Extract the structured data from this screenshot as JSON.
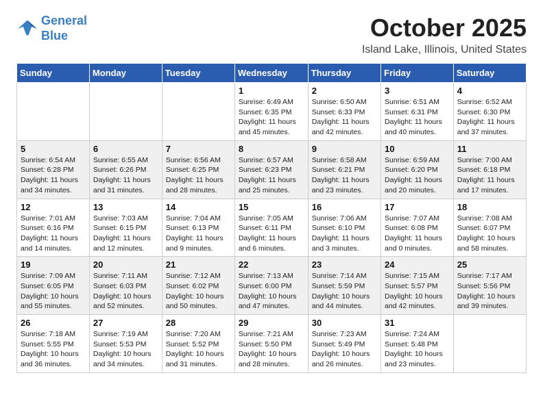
{
  "logo": {
    "line1": "General",
    "line2": "Blue"
  },
  "title": "October 2025",
  "location": "Island Lake, Illinois, United States",
  "weekdays": [
    "Sunday",
    "Monday",
    "Tuesday",
    "Wednesday",
    "Thursday",
    "Friday",
    "Saturday"
  ],
  "weeks": [
    [
      {
        "day": "",
        "info": ""
      },
      {
        "day": "",
        "info": ""
      },
      {
        "day": "",
        "info": ""
      },
      {
        "day": "1",
        "info": "Sunrise: 6:49 AM\nSunset: 6:35 PM\nDaylight: 11 hours\nand 45 minutes."
      },
      {
        "day": "2",
        "info": "Sunrise: 6:50 AM\nSunset: 6:33 PM\nDaylight: 11 hours\nand 42 minutes."
      },
      {
        "day": "3",
        "info": "Sunrise: 6:51 AM\nSunset: 6:31 PM\nDaylight: 11 hours\nand 40 minutes."
      },
      {
        "day": "4",
        "info": "Sunrise: 6:52 AM\nSunset: 6:30 PM\nDaylight: 11 hours\nand 37 minutes."
      }
    ],
    [
      {
        "day": "5",
        "info": "Sunrise: 6:54 AM\nSunset: 6:28 PM\nDaylight: 11 hours\nand 34 minutes."
      },
      {
        "day": "6",
        "info": "Sunrise: 6:55 AM\nSunset: 6:26 PM\nDaylight: 11 hours\nand 31 minutes."
      },
      {
        "day": "7",
        "info": "Sunrise: 6:56 AM\nSunset: 6:25 PM\nDaylight: 11 hours\nand 28 minutes."
      },
      {
        "day": "8",
        "info": "Sunrise: 6:57 AM\nSunset: 6:23 PM\nDaylight: 11 hours\nand 25 minutes."
      },
      {
        "day": "9",
        "info": "Sunrise: 6:58 AM\nSunset: 6:21 PM\nDaylight: 11 hours\nand 23 minutes."
      },
      {
        "day": "10",
        "info": "Sunrise: 6:59 AM\nSunset: 6:20 PM\nDaylight: 11 hours\nand 20 minutes."
      },
      {
        "day": "11",
        "info": "Sunrise: 7:00 AM\nSunset: 6:18 PM\nDaylight: 11 hours\nand 17 minutes."
      }
    ],
    [
      {
        "day": "12",
        "info": "Sunrise: 7:01 AM\nSunset: 6:16 PM\nDaylight: 11 hours\nand 14 minutes."
      },
      {
        "day": "13",
        "info": "Sunrise: 7:03 AM\nSunset: 6:15 PM\nDaylight: 11 hours\nand 12 minutes."
      },
      {
        "day": "14",
        "info": "Sunrise: 7:04 AM\nSunset: 6:13 PM\nDaylight: 11 hours\nand 9 minutes."
      },
      {
        "day": "15",
        "info": "Sunrise: 7:05 AM\nSunset: 6:11 PM\nDaylight: 11 hours\nand 6 minutes."
      },
      {
        "day": "16",
        "info": "Sunrise: 7:06 AM\nSunset: 6:10 PM\nDaylight: 11 hours\nand 3 minutes."
      },
      {
        "day": "17",
        "info": "Sunrise: 7:07 AM\nSunset: 6:08 PM\nDaylight: 11 hours\nand 0 minutes."
      },
      {
        "day": "18",
        "info": "Sunrise: 7:08 AM\nSunset: 6:07 PM\nDaylight: 10 hours\nand 58 minutes."
      }
    ],
    [
      {
        "day": "19",
        "info": "Sunrise: 7:09 AM\nSunset: 6:05 PM\nDaylight: 10 hours\nand 55 minutes."
      },
      {
        "day": "20",
        "info": "Sunrise: 7:11 AM\nSunset: 6:03 PM\nDaylight: 10 hours\nand 52 minutes."
      },
      {
        "day": "21",
        "info": "Sunrise: 7:12 AM\nSunset: 6:02 PM\nDaylight: 10 hours\nand 50 minutes."
      },
      {
        "day": "22",
        "info": "Sunrise: 7:13 AM\nSunset: 6:00 PM\nDaylight: 10 hours\nand 47 minutes."
      },
      {
        "day": "23",
        "info": "Sunrise: 7:14 AM\nSunset: 5:59 PM\nDaylight: 10 hours\nand 44 minutes."
      },
      {
        "day": "24",
        "info": "Sunrise: 7:15 AM\nSunset: 5:57 PM\nDaylight: 10 hours\nand 42 minutes."
      },
      {
        "day": "25",
        "info": "Sunrise: 7:17 AM\nSunset: 5:56 PM\nDaylight: 10 hours\nand 39 minutes."
      }
    ],
    [
      {
        "day": "26",
        "info": "Sunrise: 7:18 AM\nSunset: 5:55 PM\nDaylight: 10 hours\nand 36 minutes."
      },
      {
        "day": "27",
        "info": "Sunrise: 7:19 AM\nSunset: 5:53 PM\nDaylight: 10 hours\nand 34 minutes."
      },
      {
        "day": "28",
        "info": "Sunrise: 7:20 AM\nSunset: 5:52 PM\nDaylight: 10 hours\nand 31 minutes."
      },
      {
        "day": "29",
        "info": "Sunrise: 7:21 AM\nSunset: 5:50 PM\nDaylight: 10 hours\nand 28 minutes."
      },
      {
        "day": "30",
        "info": "Sunrise: 7:23 AM\nSunset: 5:49 PM\nDaylight: 10 hours\nand 26 minutes."
      },
      {
        "day": "31",
        "info": "Sunrise: 7:24 AM\nSunset: 5:48 PM\nDaylight: 10 hours\nand 23 minutes."
      },
      {
        "day": "",
        "info": ""
      }
    ]
  ]
}
